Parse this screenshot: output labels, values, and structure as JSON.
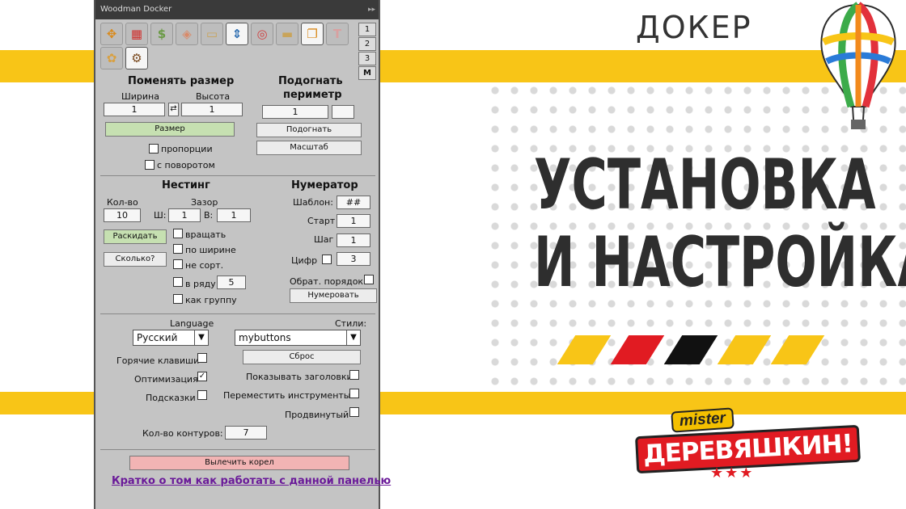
{
  "header": {
    "word": "ДОКЕР"
  },
  "title": {
    "line1": "УСТАНОВКА",
    "line2": "И НАСТРОЙКА"
  },
  "stripe_colors": [
    "#f8c517",
    "#e11b22",
    "#111111",
    "#f8c517",
    "#f8c517"
  ],
  "brand": {
    "small": "mister",
    "name": "ДЕРЕВЯШКИН!",
    "stars": "★★★"
  },
  "colors": {
    "yellow": "#f8c517",
    "red": "#e11b22"
  },
  "docker": {
    "title": "Woodman Docker",
    "tools_row1": [
      {
        "icon": "move-arrows-icon",
        "glyph": "✥",
        "color": "#d98a1c"
      },
      {
        "icon": "color-blocks-icon",
        "glyph": "▦",
        "color": "#d0302e"
      },
      {
        "icon": "dollar-coin-icon",
        "glyph": "$",
        "color": "#6a9a45"
      },
      {
        "icon": "diamond-shapes-icon",
        "glyph": "◈",
        "color": "#d98a6a"
      },
      {
        "icon": "frame-icon",
        "glyph": "▭",
        "color": "#c9a45a"
      },
      {
        "icon": "resize-arrows-icon",
        "glyph": "⇕",
        "color": "#2b6cb0",
        "selected": true
      },
      {
        "icon": "circle-target-icon",
        "glyph": "◎",
        "color": "#d04040"
      },
      {
        "icon": "rectangle-icon",
        "glyph": "▬",
        "color": "#c9a45a"
      },
      {
        "icon": "layers-icon",
        "glyph": "❐",
        "color": "#d98a1c",
        "selected": true
      },
      {
        "icon": "text-t-icon",
        "glyph": "T",
        "color": "#d9a0a0"
      }
    ],
    "tools_row2": [
      {
        "icon": "puzzle-icon",
        "glyph": "✿",
        "color": "#d9a040"
      },
      {
        "icon": "gear-icon",
        "glyph": "⚙",
        "color": "#7a4a20",
        "selected": true
      }
    ],
    "side_tabs": [
      "1",
      "2",
      "3",
      "M"
    ],
    "resize": {
      "title": "Поменять размер",
      "width_label": "Ширина",
      "height_label": "Высота",
      "width_value": "1",
      "height_value": "1",
      "swap": "⇄",
      "size_button": "Размер",
      "proportions": "пропорции",
      "with_rotation": "с поворотом"
    },
    "fit": {
      "title1": "Подогнать",
      "title2": "периметр",
      "value": "1",
      "value2": "",
      "fit_button": "Подогнать",
      "scale_button": "Масштаб"
    },
    "nesting": {
      "title": "Нестинг",
      "count_label": "Кол-во",
      "gap_label": "Зазор",
      "count_value": "10",
      "w_label": "Ш:",
      "w_value": "1",
      "h_label": "В:",
      "h_value": "1",
      "distribute_button": "Раскидать",
      "howmany_button": "Сколько?",
      "rotate": "вращать",
      "by_width": "по ширине",
      "no_sort": "не сорт.",
      "in_row": "в ряду",
      "in_row_value": "5",
      "as_group": "как группу"
    },
    "numerator": {
      "title": "Нумератор",
      "template_label": "Шаблон:",
      "template_value": "##",
      "start_label": "Старт",
      "start_value": "1",
      "step_label": "Шаг",
      "step_value": "1",
      "digits_label": "Цифр",
      "digits_value": "3",
      "reverse_label": "Обрат. порядок",
      "number_button": "Нумеровать"
    },
    "settings": {
      "language_label": "Language",
      "language_value": "Русский",
      "styles_label": "Стили:",
      "styles_value": "mybuttons",
      "reset_button": "Сброс",
      "hotkeys": "Горячие клавиши",
      "optimization": "Оптимизация",
      "optimization_checked": "✓",
      "hints": "Подсказки",
      "show_headers": "Показывать заголовки",
      "move_tools": "Переместить инструменты",
      "advanced": "Продвинутый",
      "contours_label": "Кол-во контуров:",
      "contours_value": "7"
    },
    "fix_button": "Вылечить корел",
    "help_link": "Кратко о том как работать с данной панелью"
  }
}
